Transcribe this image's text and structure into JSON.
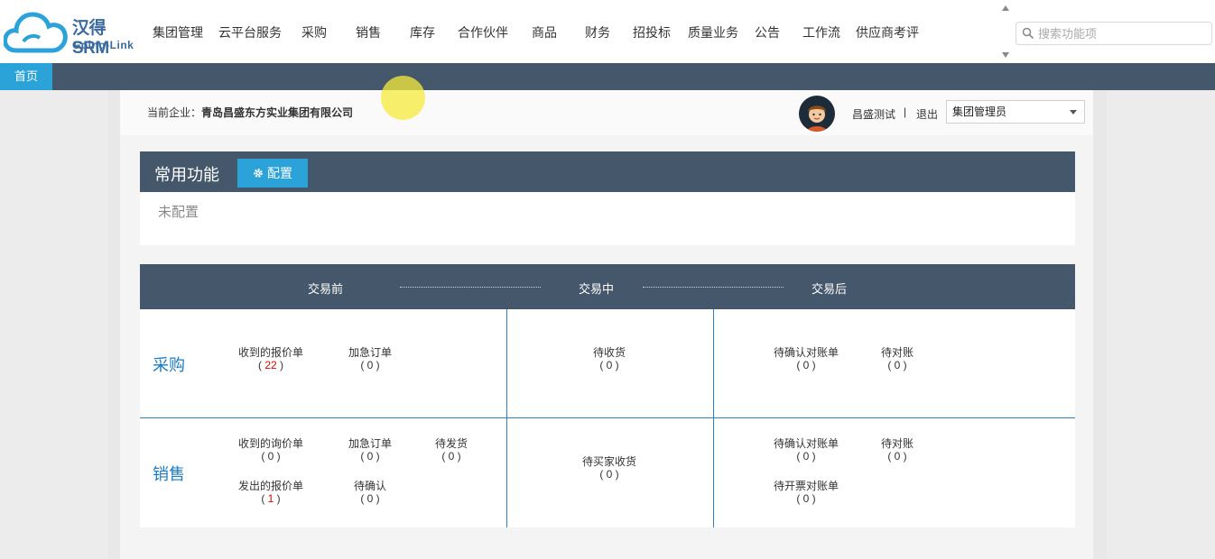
{
  "brand": {
    "title": "汉得SRM",
    "subtitle": "Going-Link"
  },
  "nav": {
    "items": [
      "集团管理",
      "云平台服务",
      "采购",
      "销售",
      "库存",
      "合作伙伴",
      "商品",
      "财务",
      "招投标",
      "质量业务",
      "公告",
      "工作流",
      "供应商考评"
    ]
  },
  "search": {
    "placeholder": "搜索功能项"
  },
  "tabs": {
    "home": "首页"
  },
  "userbar": {
    "company_label": "当前企业：",
    "company_name": "青岛昌盛东方实业集团有限公司",
    "username": "昌盛测试",
    "separator": "|",
    "logout": "退出",
    "role": "集团管理员"
  },
  "common": {
    "title": "常用功能",
    "config_button": "配置",
    "empty_text": "未配置"
  },
  "trade": {
    "headers": {
      "before": "交易前",
      "during": "交易中",
      "after": "交易后"
    },
    "purchase": {
      "label": "采购",
      "before": [
        {
          "name": "收到的报价单",
          "count": "22",
          "highlight": true
        },
        {
          "name": "加急订单",
          "count": "0",
          "highlight": false
        }
      ],
      "during": [
        {
          "name": "待收货",
          "count": "0",
          "highlight": false
        }
      ],
      "after": [
        {
          "name": "待确认对账单",
          "count": "0",
          "highlight": false
        },
        {
          "name": "待对账",
          "count": "0",
          "highlight": false
        }
      ]
    },
    "sales": {
      "label": "销售",
      "before": [
        {
          "name": "收到的询价单",
          "count": "0",
          "highlight": false
        },
        {
          "name": "加急订单",
          "count": "0",
          "highlight": false
        },
        {
          "name": "待发货",
          "count": "0",
          "highlight": false
        },
        {
          "name": "发出的报价单",
          "count": "1",
          "highlight": true
        },
        {
          "name": "待确认",
          "count": "0",
          "highlight": false
        }
      ],
      "during": [
        {
          "name": "待买家收货",
          "count": "0",
          "highlight": false
        }
      ],
      "after": [
        {
          "name": "待确认对账单",
          "count": "0",
          "highlight": false
        },
        {
          "name": "待对账",
          "count": "0",
          "highlight": false
        },
        {
          "name": "待开票对账单",
          "count": "0",
          "highlight": false
        }
      ]
    }
  },
  "colors": {
    "header_bg": "#44576b",
    "accent": "#2ba3d9",
    "divider": "#2b7fc4",
    "highlight": "#dd0000"
  }
}
